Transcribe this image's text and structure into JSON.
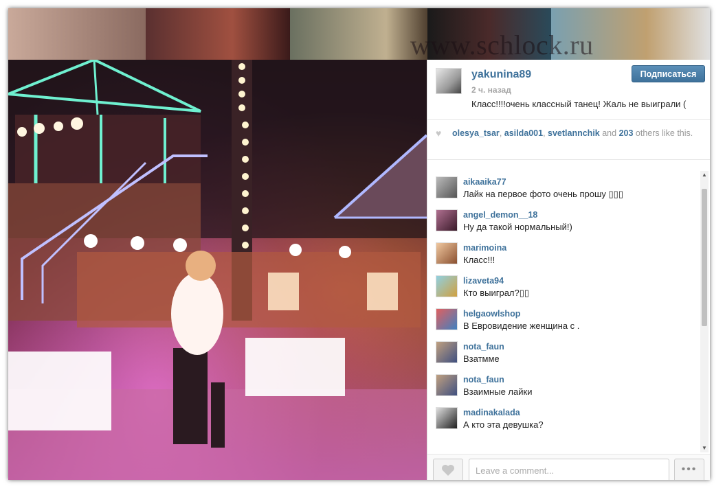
{
  "watermark": "www.schlock.ru",
  "post": {
    "username": "yakunina89",
    "time": "2 ч. назад",
    "caption": "Класс!!!!очень классный танец! Жаль не выиграли (",
    "follow_label": "Подписаться"
  },
  "likes": {
    "users": [
      "olesya_tsar",
      "asilda001",
      "svetlannchik"
    ],
    "sep1": ", ",
    "sep2": ", ",
    "and_text": " and ",
    "count": "203",
    "others_text": " others like this."
  },
  "comments": [
    {
      "user": "aikaaika77",
      "text": "Лайк на первое фото очень прошу ▯▯▯",
      "avatar_color": "#6a6a6a"
    },
    {
      "user": "angel_demon__18",
      "text": "Ну да такой нормальный!)",
      "avatar_color": "#7a3a5a"
    },
    {
      "user": "marimoina",
      "text": "Класс!!!",
      "avatar_color": "#c89070"
    },
    {
      "user": "lizaveta94",
      "text": "Кто выиграл?▯▯",
      "avatar_color": "#5a9ab0"
    },
    {
      "user": "helgaowlshop",
      "text": "В Евровидение женщина с .",
      "avatar_color": "#c04040"
    },
    {
      "user": "nota_faun",
      "text": "Взатмме",
      "avatar_color": "#6a7aa0"
    },
    {
      "user": "nota_faun",
      "text": "Взаимные лайки",
      "avatar_color": "#6a7aa0"
    },
    {
      "user": "madinakalada",
      "text": "А кто эта девушка?",
      "avatar_color": "#3a3a3a"
    }
  ],
  "comment_input": {
    "placeholder": "Leave a comment..."
  },
  "more_label": "•••",
  "scroll": {
    "up": "▲",
    "down": "▼"
  }
}
